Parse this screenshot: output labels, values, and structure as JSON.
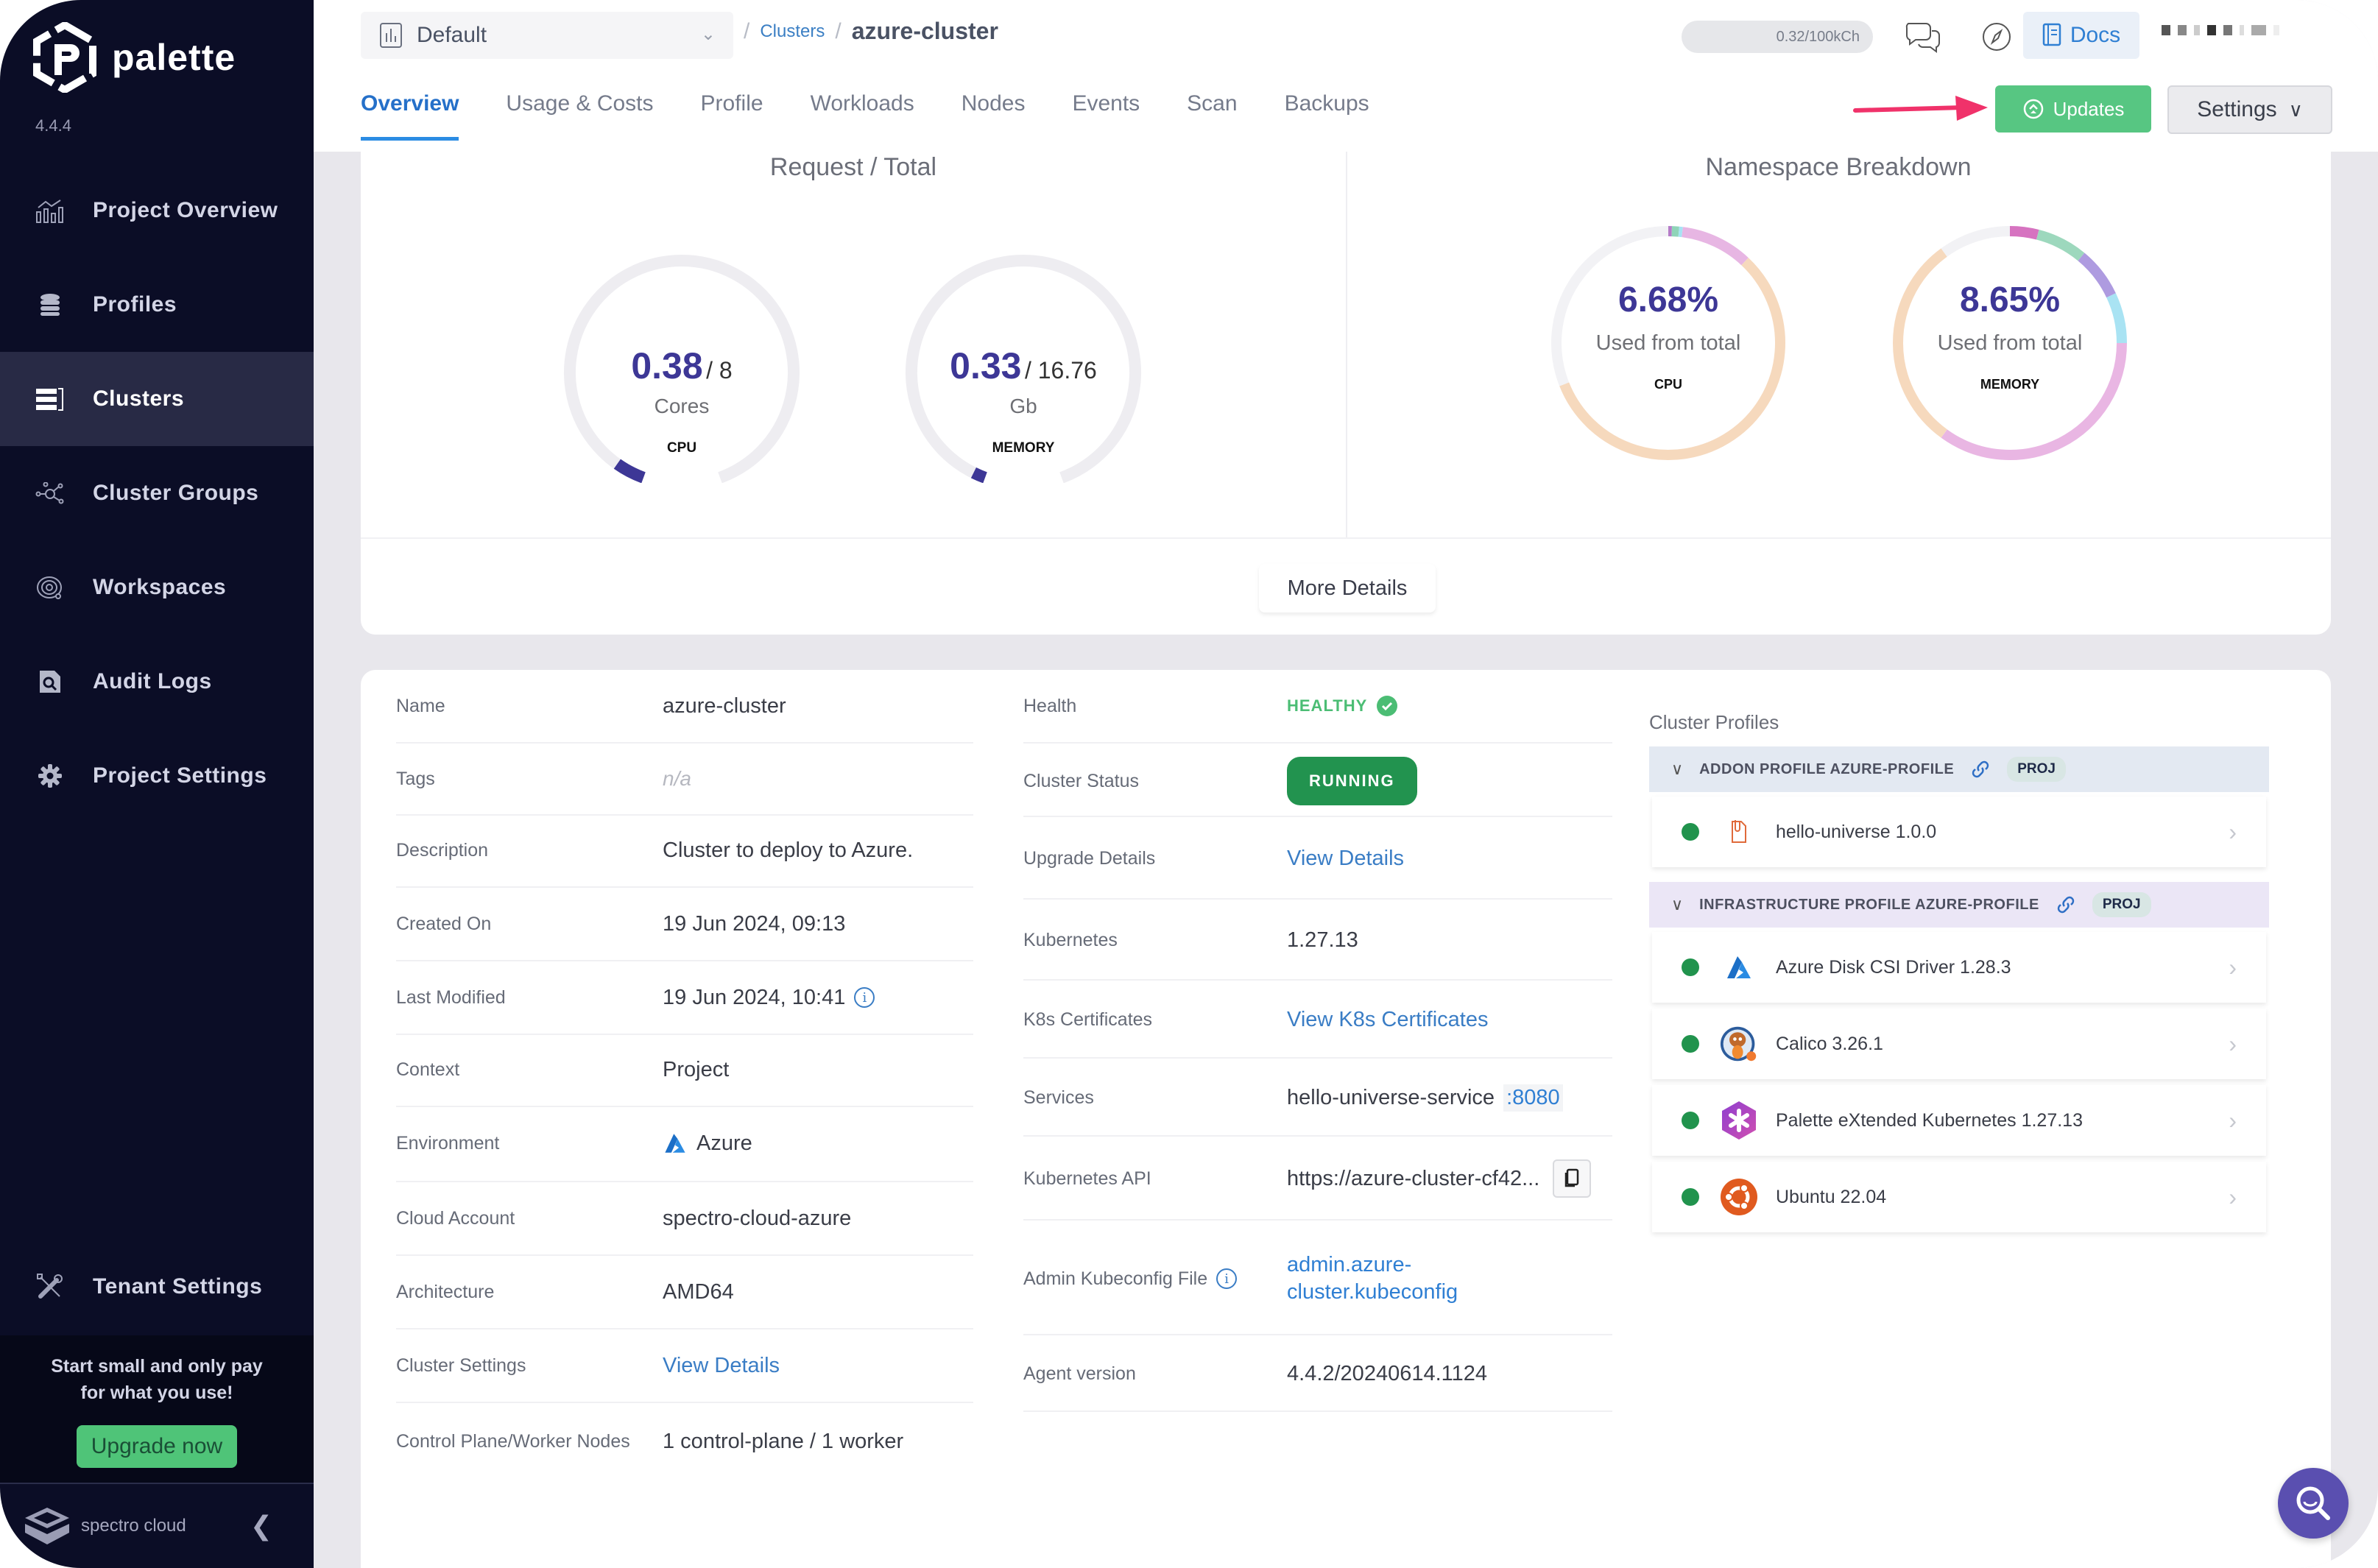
{
  "brand": {
    "name": "palette",
    "version": "4.4.4"
  },
  "sidebar": {
    "items": [
      {
        "label": "Project Overview",
        "icon": "chart-line-icon",
        "active": false
      },
      {
        "label": "Profiles",
        "icon": "layers-icon",
        "active": false
      },
      {
        "label": "Clusters",
        "icon": "clusters-icon",
        "active": true
      },
      {
        "label": "Cluster Groups",
        "icon": "network-icon",
        "active": false
      },
      {
        "label": "Workspaces",
        "icon": "workspace-icon",
        "active": false
      },
      {
        "label": "Audit Logs",
        "icon": "audit-log-icon",
        "active": false
      },
      {
        "label": "Project Settings",
        "icon": "gear-icon",
        "active": false
      }
    ],
    "tenant_settings": "Tenant Settings",
    "promo_text_line1": "Start small and only pay",
    "promo_text_line2": "for what you use!",
    "upgrade_label": "Upgrade now",
    "footer_brand": "spectro cloud"
  },
  "header": {
    "project": "Default",
    "breadcrumb": {
      "parent": "Clusters",
      "current": "azure-cluster"
    },
    "usage": "0.32/100kCh",
    "docs_label": "Docs",
    "tabs": [
      "Overview",
      "Usage & Costs",
      "Profile",
      "Workloads",
      "Nodes",
      "Events",
      "Scan",
      "Backups"
    ],
    "active_tab": "Overview",
    "updates_label": "Updates",
    "settings_label": "Settings"
  },
  "overview": {
    "request_total": {
      "title": "Request / Total",
      "cpu": {
        "value": "0.38",
        "total": "/ 8",
        "unit": "Cores",
        "label": "CPU",
        "fraction": 0.0475
      },
      "memory": {
        "value": "0.33",
        "total": "/ 16.76",
        "unit": "Gb",
        "label": "MEMORY",
        "fraction": 0.0197
      }
    },
    "namespace_breakdown": {
      "title": "Namespace Breakdown",
      "cpu": {
        "percent": "6.68%",
        "sub": "Used from total",
        "label": "CPU"
      },
      "memory": {
        "percent": "8.65%",
        "sub": "Used from total",
        "label": "MEMORY"
      }
    },
    "more_details_label": "More Details"
  },
  "chart_data": [
    {
      "type": "pie",
      "title": "Namespace Breakdown CPU",
      "note": "Donut ring; segment shares estimated from arc lengths",
      "segments": [
        {
          "color": "#b57bc8",
          "share": 0.005
        },
        {
          "color": "#8fd4b8",
          "share": 0.01
        },
        {
          "color": "#a7e3f3",
          "share": 0.005
        },
        {
          "color": "#e7b6e3",
          "share": 0.1
        },
        {
          "color": "#f6d9bd",
          "share": 0.57
        },
        {
          "color": "#f2f2f5",
          "share": 0.31
        }
      ],
      "center_label": "6.68%"
    },
    {
      "type": "pie",
      "title": "Namespace Breakdown MEMORY",
      "note": "Donut ring; segment shares estimated from arc lengths",
      "segments": [
        {
          "color": "#d673c0",
          "share": 0.04
        },
        {
          "color": "#9dd8bd",
          "share": 0.07
        },
        {
          "color": "#ae9be0",
          "share": 0.07
        },
        {
          "color": "#a9e3f3",
          "share": 0.07
        },
        {
          "color": "#e9b6e3",
          "share": 0.35
        },
        {
          "color": "#f6d9bd",
          "share": 0.3
        },
        {
          "color": "#f2f2f5",
          "share": 0.1
        }
      ],
      "center_label": "8.65%"
    }
  ],
  "details": {
    "left": [
      {
        "label": "Name",
        "value": "azure-cluster"
      },
      {
        "label": "Tags",
        "value": "n/a"
      },
      {
        "label": "Description",
        "value": "Cluster to deploy to Azure."
      },
      {
        "label": "Created On",
        "value": "19 Jun 2024, 09:13"
      },
      {
        "label": "Last Modified",
        "value": "19 Jun 2024, 10:41"
      },
      {
        "label": "Context",
        "value": "Project"
      },
      {
        "label": "Environment",
        "value": "Azure"
      },
      {
        "label": "Cloud Account",
        "value": "spectro-cloud-azure"
      },
      {
        "label": "Architecture",
        "value": "AMD64"
      },
      {
        "label": "Cluster Settings",
        "value": "View Details"
      },
      {
        "label": "Control Plane/Worker Nodes",
        "value": "1 control-plane / 1 worker"
      }
    ],
    "right": [
      {
        "label": "Health",
        "value": "HEALTHY"
      },
      {
        "label": "Cluster Status",
        "value": "RUNNING"
      },
      {
        "label": "Upgrade Details",
        "value": "View Details"
      },
      {
        "label": "Kubernetes",
        "value": "1.27.13"
      },
      {
        "label": "K8s Certificates",
        "value": "View K8s Certificates"
      },
      {
        "label": "Services",
        "value": "hello-universe-service",
        "port": ":8080"
      },
      {
        "label": "Kubernetes API",
        "value": "https://azure-cluster-cf42..."
      },
      {
        "label": "Admin Kubeconfig File",
        "value_line1": "admin.azure-",
        "value_line2": "cluster.kubeconfig"
      },
      {
        "label": "Agent version",
        "value": "4.4.2/20240614.1124"
      }
    ]
  },
  "cluster_profiles": {
    "title": "Cluster Profiles",
    "groups": [
      {
        "name": "ADDON PROFILE AZURE-PROFILE",
        "badge": "PROJ",
        "items": [
          {
            "name": "hello-universe 1.0.0",
            "icon": "manifest-file-icon"
          }
        ]
      },
      {
        "name": "INFRASTRUCTURE PROFILE AZURE-PROFILE",
        "badge": "PROJ",
        "items": [
          {
            "name": "Azure Disk CSI Driver 1.28.3",
            "icon": "azure-icon"
          },
          {
            "name": "Calico 3.26.1",
            "icon": "calico-icon"
          },
          {
            "name": "Palette eXtended Kubernetes 1.27.13",
            "icon": "pxk-icon"
          },
          {
            "name": "Ubuntu 22.04",
            "icon": "ubuntu-icon"
          }
        ]
      }
    ]
  },
  "colors": {
    "sidebar_bg": "#0b0d26",
    "accent_blue": "#2b8ce3",
    "success_green": "#57c682",
    "running_green": "#22934f",
    "gauge_purple": "#3d3796"
  }
}
